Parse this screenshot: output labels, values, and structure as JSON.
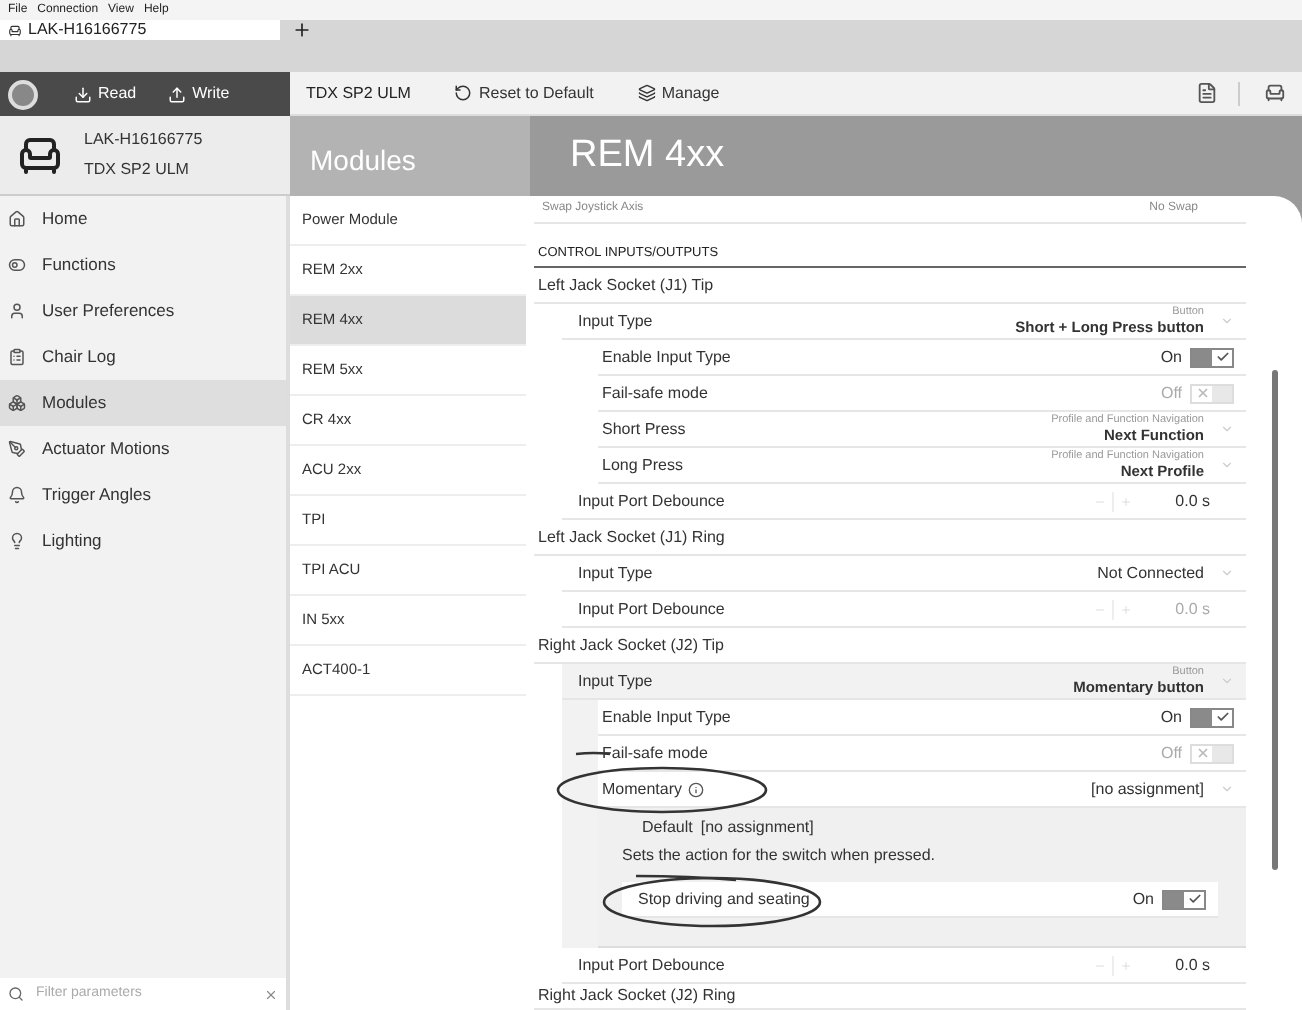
{
  "menu": [
    "File",
    "Connection",
    "View",
    "Help"
  ],
  "tabs": [
    {
      "label": "LAK-H16166775",
      "selected": true
    }
  ],
  "toolbar": {
    "read": "Read",
    "write": "Write",
    "device": "TDX SP2 ULM",
    "actions": [
      {
        "kind": "reset",
        "label": "Reset to Default"
      },
      {
        "kind": "manage",
        "label": "Manage"
      }
    ]
  },
  "device": {
    "name": "LAK-H16166775",
    "model": "TDX SP2 ULM"
  },
  "sidebar": {
    "items": [
      {
        "kind": "home",
        "label": "Home",
        "selected": false
      },
      {
        "kind": "functions",
        "label": "Functions",
        "selected": false
      },
      {
        "kind": "user",
        "label": "User Preferences",
        "selected": false
      },
      {
        "kind": "log",
        "label": "Chair Log",
        "selected": false
      },
      {
        "kind": "modules",
        "label": "Modules",
        "selected": true
      },
      {
        "kind": "actuator",
        "label": "Actuator Motions",
        "selected": false
      },
      {
        "kind": "angles",
        "label": "Trigger Angles",
        "selected": false
      },
      {
        "kind": "lighting",
        "label": "Lighting",
        "selected": false
      }
    ],
    "filter_placeholder": "Filter parameters"
  },
  "modules_title": "Modules",
  "modules": [
    {
      "label": "Power Module",
      "selected": false
    },
    {
      "label": "REM 2xx",
      "selected": false
    },
    {
      "label": "REM 4xx",
      "selected": true
    },
    {
      "label": "REM 5xx",
      "selected": false
    },
    {
      "label": "CR 4xx",
      "selected": false
    },
    {
      "label": "ACU 2xx",
      "selected": false
    },
    {
      "label": "TPI",
      "selected": false
    },
    {
      "label": "TPI ACU",
      "selected": false
    },
    {
      "label": "IN 5xx",
      "selected": false
    },
    {
      "label": "ACT400-1",
      "selected": false
    }
  ],
  "page_title": "REM 4xx",
  "top_row": {
    "label": "Swap Joystick Axis",
    "value": "No Swap"
  },
  "section_title": "CONTROL INPUTS/OUTPUTS",
  "groups": [
    {
      "title": "Left Jack Socket (J1) Tip",
      "params": [
        {
          "kind": "dropdown",
          "label": "Input Type",
          "caption": "Button",
          "value": "Short + Long Press button",
          "highlighted": false,
          "children": [
            {
              "kind": "toggle",
              "label": "Enable Input Type",
              "value": "On",
              "on": true
            },
            {
              "kind": "toggle",
              "label": "Fail-safe mode",
              "value": "Off",
              "on": false
            },
            {
              "kind": "dropdown",
              "label": "Short Press",
              "caption": "Profile and Function Navigation",
              "value": "Next Function"
            },
            {
              "kind": "dropdown",
              "label": "Long Press",
              "caption": "Profile and Function Navigation",
              "value": "Next Profile"
            }
          ]
        },
        {
          "kind": "stepper",
          "label": "Input Port Debounce",
          "value": "0.0 s",
          "disabled": false,
          "highlighted": false
        }
      ]
    },
    {
      "title": "Left Jack Socket (J1) Ring",
      "params": [
        {
          "kind": "dropdown",
          "label": "Input Type",
          "value": "Not Connected",
          "highlighted": false
        },
        {
          "kind": "stepper",
          "label": "Input Port Debounce",
          "value": "0.0 s",
          "disabled": true,
          "highlighted": false
        }
      ]
    },
    {
      "title": "Right Jack Socket (J2) Tip",
      "params": [
        {
          "kind": "dropdown",
          "label": "Input Type",
          "caption": "Button",
          "value": "Momentary button",
          "highlighted": true,
          "children": [
            {
              "kind": "toggle",
              "label": "Enable Input Type",
              "value": "On",
              "on": true
            },
            {
              "kind": "toggle",
              "label": "Fail-safe mode",
              "value": "Off",
              "on": false
            },
            {
              "kind": "dropdown",
              "label": "Momentary",
              "info": true,
              "value": "[no assignment]",
              "detail": {
                "default_label": "Default",
                "default_value": "[no assignment]",
                "description": "Sets the action for the switch when pressed.",
                "options": [
                  {
                    "label": "Stop driving and seating",
                    "value": "On",
                    "on": true
                  }
                ]
              }
            }
          ]
        },
        {
          "kind": "stepper",
          "label": "Input Port Debounce",
          "value": "0.0 s",
          "disabled": false,
          "highlighted": false
        }
      ]
    },
    {
      "title": "Right Jack Socket (J2) Ring"
    }
  ]
}
